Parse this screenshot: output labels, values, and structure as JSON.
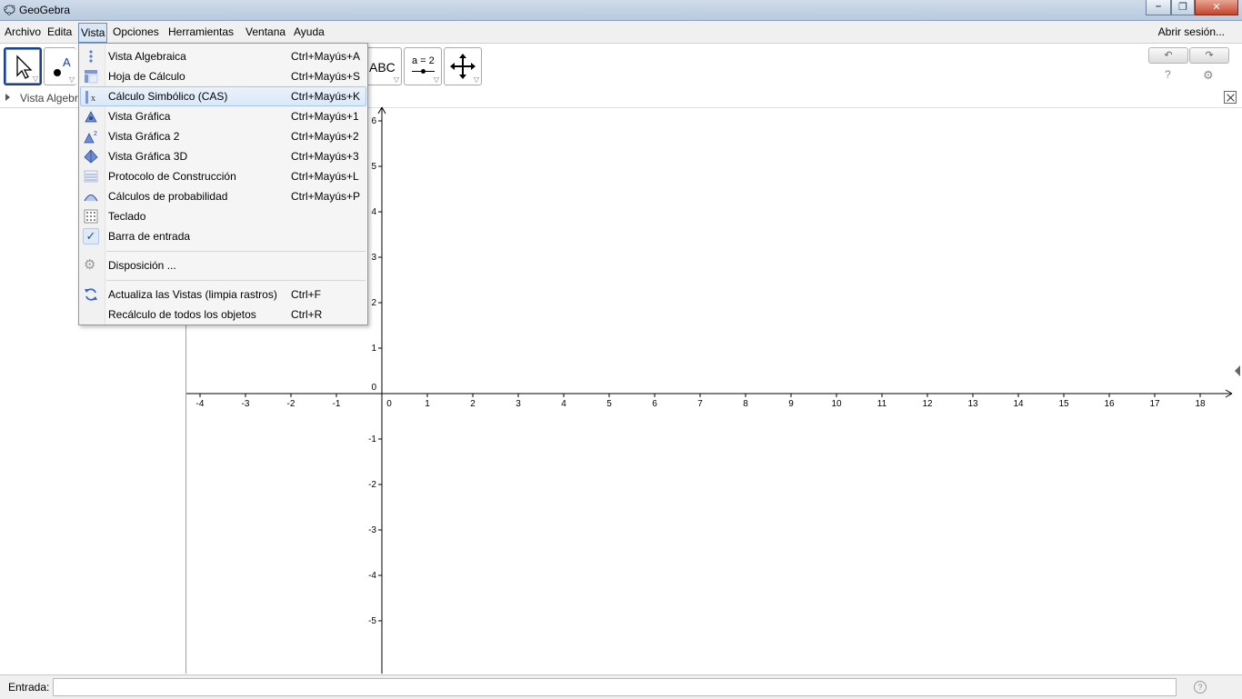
{
  "window": {
    "title": "GeoGebra"
  },
  "menubar": {
    "items": [
      "Archivo",
      "Edita",
      "Vista",
      "Opciones",
      "Herramientas",
      "Ventana",
      "Ayuda"
    ],
    "open_item": "Vista",
    "session": "Abrir sesión..."
  },
  "toolbar": {
    "tools": [
      {
        "name": "move-tool",
        "icon": "pointer-icon",
        "selected": true
      },
      {
        "name": "point-tool",
        "icon": "point-icon"
      },
      {
        "name": "text-tool",
        "icon": "text-icon",
        "label": "ABC"
      },
      {
        "name": "slider-tool",
        "icon": "slider-icon",
        "label": "a = 2"
      },
      {
        "name": "move-graphics-tool",
        "icon": "move-cross-icon"
      }
    ],
    "undo_icon": "undo-icon",
    "redo_icon": "redo-icon",
    "help_glyph": "?",
    "settings_icon": "gear-icon"
  },
  "algebra_view": {
    "title": "Vista Algebraica"
  },
  "vista_menu": {
    "items": [
      {
        "label": "Vista Algebraica",
        "shortcut": "Ctrl+Mayús+A",
        "icon": "algebra-view-icon"
      },
      {
        "label": "Hoja de Cálculo",
        "shortcut": "Ctrl+Mayús+S",
        "icon": "spreadsheet-icon"
      },
      {
        "label": "Cálculo Simbólico (CAS)",
        "shortcut": "Ctrl+Mayús+K",
        "icon": "cas-icon",
        "highlighted": true
      },
      {
        "label": "Vista Gráfica",
        "shortcut": "Ctrl+Mayús+1",
        "icon": "graphics-view-icon"
      },
      {
        "label": "Vista Gráfica 2",
        "shortcut": "Ctrl+Mayús+2",
        "icon": "graphics-view-2-icon"
      },
      {
        "label": "Vista Gráfica 3D",
        "shortcut": "Ctrl+Mayús+3",
        "icon": "graphics-3d-icon"
      },
      {
        "label": "Protocolo de Construcción",
        "shortcut": "Ctrl+Mayús+L",
        "icon": "construction-protocol-icon"
      },
      {
        "label": "Cálculos de probabilidad",
        "shortcut": "Ctrl+Mayús+P",
        "icon": "probability-icon"
      },
      {
        "label": "Teclado",
        "shortcut": "",
        "icon": "keyboard-icon"
      },
      {
        "label": "Barra de entrada",
        "shortcut": "",
        "icon": "checkmark-icon",
        "checked": true
      },
      {
        "label": "Disposición ...",
        "shortcut": "",
        "icon": "layout-gear-icon"
      },
      {
        "label": "Actualiza las Vistas (limpia rastros)",
        "shortcut": "Ctrl+F",
        "icon": "refresh-icon"
      },
      {
        "label": "Recálculo de todos los objetos",
        "shortcut": "Ctrl+R",
        "icon": ""
      }
    ]
  },
  "graphics": {
    "x_ticks": [
      "-4",
      "-3",
      "-2",
      "-1",
      "0",
      "1",
      "2",
      "3",
      "4",
      "5",
      "6",
      "7",
      "8",
      "9",
      "10",
      "11",
      "12",
      "13",
      "14",
      "15",
      "16",
      "17",
      "18"
    ],
    "y_ticks": [
      "6",
      "5",
      "4",
      "3",
      "2",
      "1",
      "0",
      "-1",
      "-2",
      "-3",
      "-4",
      "-5"
    ],
    "grid": false,
    "colors": {
      "axes": "#000000",
      "axis_labels": "#000000"
    }
  },
  "input_bar": {
    "label": "Entrada:",
    "value": "",
    "help_glyph": "?"
  }
}
